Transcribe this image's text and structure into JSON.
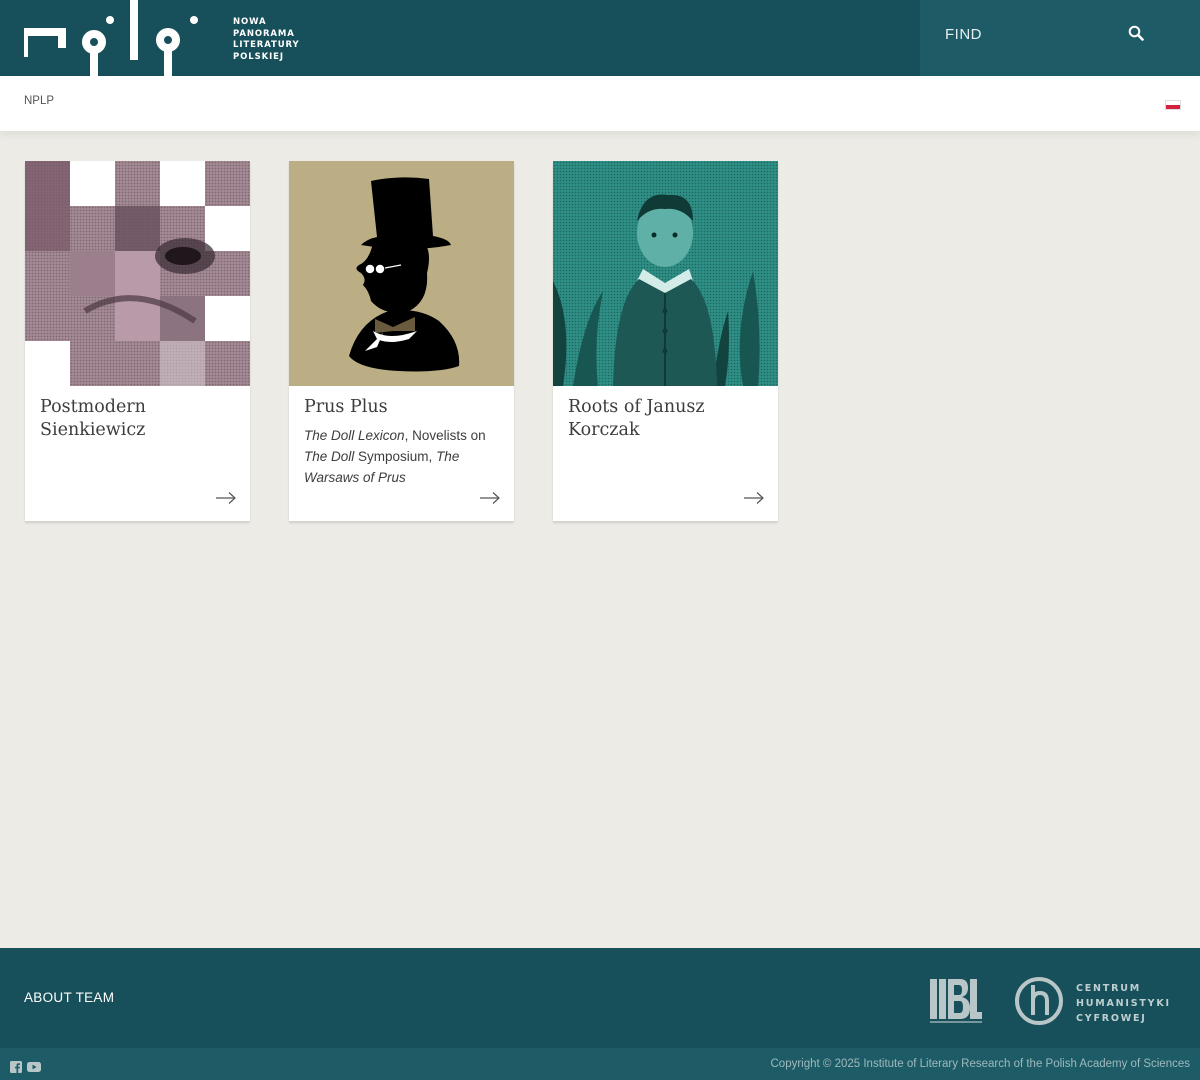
{
  "header": {
    "logo_lines": [
      "NOWA",
      "PANORAMA",
      "LITERATURY",
      "POLSKIEJ"
    ],
    "search_placeholder": "FIND",
    "search_icon": "search-icon"
  },
  "breadcrumb": {
    "label": "NPLP",
    "language_icon": "polish-flag-icon"
  },
  "cards": [
    {
      "title": "Postmodern Sienkiewicz",
      "description": [],
      "image_icon": "sienkiewicz-portrait-mosaic-image",
      "arrow_icon": "arrow-right-icon"
    },
    {
      "title": "Prus Plus",
      "description": [
        {
          "text": "The Doll Lexicon",
          "italic": true
        },
        {
          "text": ", Novelists on ",
          "italic": false
        },
        {
          "text": "The Doll",
          "italic": true
        },
        {
          "text": " Symposium, ",
          "italic": false
        },
        {
          "text": "The Warsaws of Prus",
          "italic": true
        }
      ],
      "image_icon": "prus-top-hat-silhouette-image",
      "arrow_icon": "arrow-right-icon"
    },
    {
      "title": "Roots of Janusz Korczak",
      "description": [],
      "image_icon": "korczak-boy-portrait-image",
      "arrow_icon": "arrow-right-icon"
    }
  ],
  "footer": {
    "about_label": "ABOUT TEAM",
    "partner_ibl_icon": "ibl-logo",
    "partner_chc_lines": [
      "CENTRUM",
      "HUMANISTYKI",
      "CYFROWEJ"
    ],
    "social_icons": [
      "facebook-icon",
      "youtube-icon"
    ],
    "copyright": "Copyright © 2025 Institute of Literary Research of the Polish Academy of Sciences"
  },
  "colors": {
    "header_bg": "#17505a",
    "search_bg": "#1d5c66",
    "page_bg": "#ecebe6",
    "card_bg": "#ffffff",
    "text": "#3d3d3d"
  }
}
